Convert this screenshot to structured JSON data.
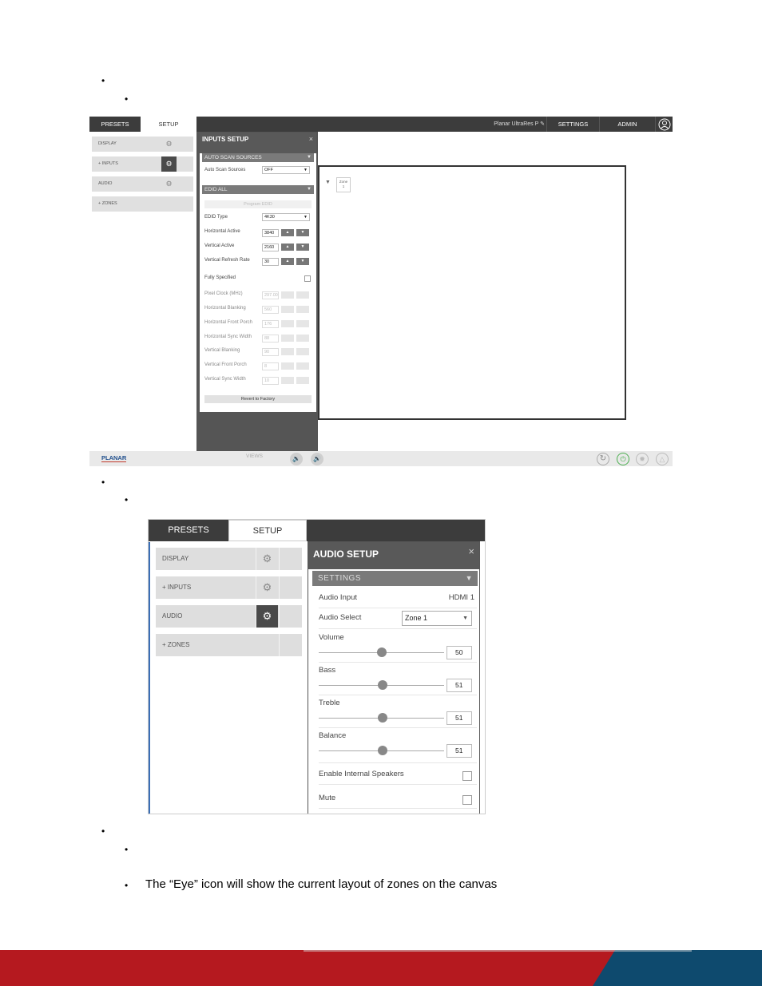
{
  "bullets": {
    "b1": "•",
    "b2": "•",
    "b3": "•",
    "b4": "•",
    "b5": "•",
    "b6": "•",
    "b7": "•",
    "eye_text": "The “Eye” icon will show the current layout of zones on the canvas"
  },
  "shot1": {
    "tabs": {
      "presets": "PRESETS",
      "setup": "SETUP"
    },
    "top": {
      "device": "Planar UltraRes P",
      "settings": "SETTINGS",
      "admin": "ADMIN"
    },
    "sidebar": {
      "display": "DISPLAY",
      "inputs": "+ INPUTS",
      "audio": "AUDIO",
      "zones": "+ ZONES"
    },
    "panel": {
      "title": "INPUTS SETUP",
      "close": "×",
      "sec_auto": "AUTO SCAN SOURCES",
      "auto_label": "Auto Scan Sources",
      "auto_value": "OFF",
      "sec_edid": "EDID ALL",
      "program": "Program EDID",
      "edid_type_label": "EDID Type",
      "edid_type_value": "4K30",
      "h_active_label": "Horizontal Active",
      "h_active_value": "3840",
      "v_active_label": "Vertical Active",
      "v_active_value": "2160",
      "v_refresh_label": "Vertical Refresh Rate",
      "v_refresh_value": "30",
      "fully_label": "Fully Specified",
      "pixel_label": "Pixel Clock (MHz)",
      "pixel_value": "297.00",
      "h_blank_label": "Horizontal Blanking",
      "h_blank_value": "560",
      "h_front_label": "Horizontal Front Porch",
      "h_front_value": "176",
      "h_sync_label": "Horizontal Sync Width",
      "h_sync_value": "88",
      "v_blank_label": "Vertical Blanking",
      "v_blank_value": "90",
      "v_front_label": "Vertical Front Porch",
      "v_front_value": "8",
      "v_sync_label": "Vertical Sync Width",
      "v_sync_value": "10",
      "revert": "Revert to Factory"
    },
    "zone": {
      "label": "Zone",
      "number": "1"
    },
    "bottom": {
      "logo": "PLANAR",
      "views": "VIEWS"
    }
  },
  "shot2": {
    "tabs": {
      "presets": "PRESETS",
      "setup": "SETUP"
    },
    "sidebar": {
      "display": "DISPLAY",
      "inputs": "+ INPUTS",
      "audio": "AUDIO",
      "zones": "+ ZONES"
    },
    "panel": {
      "title": "AUDIO SETUP",
      "close": "×",
      "section": "SETTINGS",
      "audio_input_label": "Audio Input",
      "audio_input_value": "HDMI 1",
      "audio_select_label": "Audio Select",
      "audio_select_value": "Zone 1",
      "volume_label": "Volume",
      "volume_value": "50",
      "volume_level": 0.5,
      "bass_label": "Bass",
      "bass_value": "51",
      "bass_level": 0.51,
      "treble_label": "Treble",
      "treble_value": "51",
      "treble_level": 0.51,
      "balance_label": "Balance",
      "balance_value": "51",
      "balance_level": 0.51,
      "speakers_label": "Enable Internal Speakers",
      "mute_label": "Mute"
    }
  },
  "colors": {
    "footer_red": "#b5191f",
    "footer_blue": "#0e4a6e",
    "planar_blue": "#1f4e8c"
  }
}
